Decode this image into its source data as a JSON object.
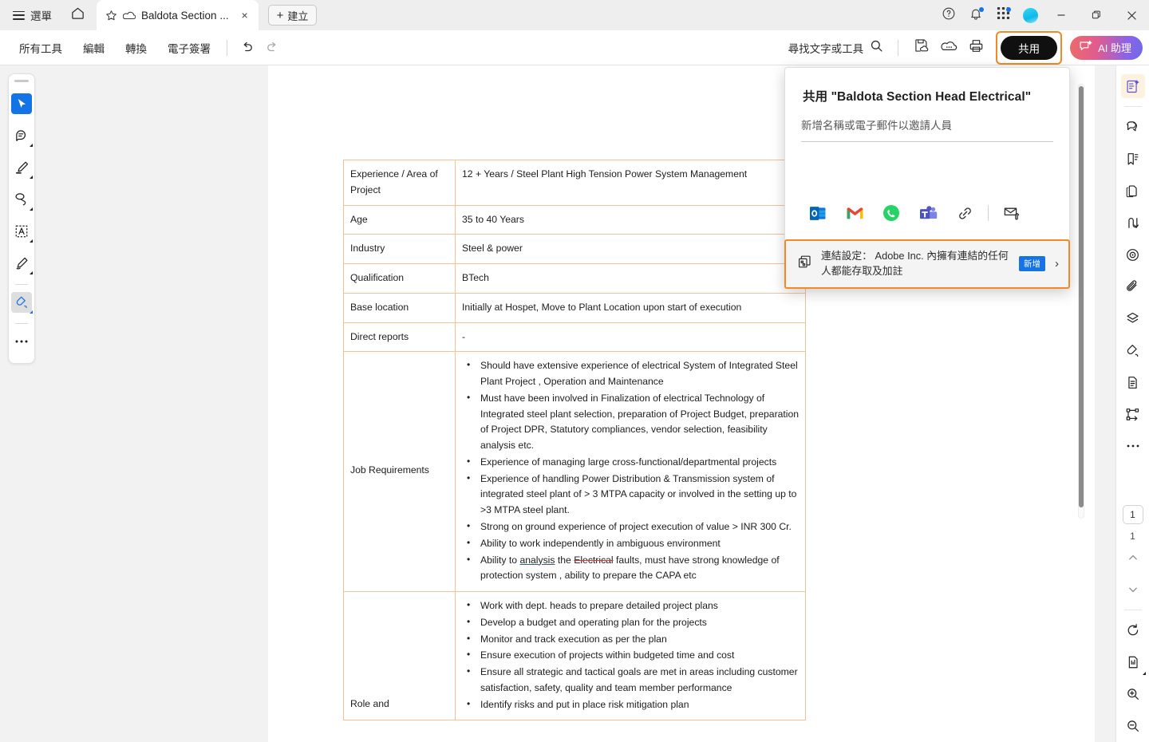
{
  "window": {
    "menu_label": "選單",
    "tab_title": "Baldota Section ...",
    "create_label": "建立",
    "minimize": "–",
    "restore": "restore",
    "close": "×"
  },
  "toolbar": {
    "items": [
      {
        "label": "所有工具",
        "name": "tool-all-tools"
      },
      {
        "label": "編輯",
        "name": "tool-edit"
      },
      {
        "label": "轉換",
        "name": "tool-convert"
      },
      {
        "label": "電子簽署",
        "name": "tool-esign"
      }
    ],
    "find_label": "尋找文字或工具",
    "share_label": "共用",
    "ai_label": "AI 助理",
    "accent_highlight": "#f08a24"
  },
  "leftrail": {
    "tools": [
      {
        "name": "select-tool",
        "label": "選取"
      },
      {
        "name": "comment-tool",
        "label": "註解"
      },
      {
        "name": "highlight-tool",
        "label": "強調"
      },
      {
        "name": "lasso-tool",
        "label": "套索"
      },
      {
        "name": "text-select-tool",
        "label": "文字選取"
      },
      {
        "name": "pen-tool",
        "label": "繪圖"
      },
      {
        "name": "fill-sign-tool",
        "label": "填寫與簽署"
      },
      {
        "name": "more-tools",
        "label": "更多"
      }
    ]
  },
  "rightrail": {
    "tools": [
      {
        "name": "ai-assistant-panel",
        "label": "AI 助理"
      },
      {
        "name": "comments-panel",
        "label": "註解"
      },
      {
        "name": "bookmarks-panel",
        "label": "書籤"
      },
      {
        "name": "organize-pages-panel",
        "label": "整理頁面"
      },
      {
        "name": "export-pdf-panel",
        "label": "匯出 PDF"
      },
      {
        "name": "redact-panel",
        "label": "塗黑"
      },
      {
        "name": "attachments-panel",
        "label": "附件"
      },
      {
        "name": "layers-panel",
        "label": "圖層"
      },
      {
        "name": "fill-sign-panel",
        "label": "填寫與簽署"
      },
      {
        "name": "document-panel",
        "label": "文件"
      },
      {
        "name": "share-workflow-panel",
        "label": "共用工作流程"
      },
      {
        "name": "more-panels",
        "label": "更多"
      }
    ],
    "current_page": "1",
    "total_pages": "1",
    "page_up": "⌃",
    "page_down": "⌄"
  },
  "share_panel": {
    "title": "共用 \"Baldota Section Head Electrical\"",
    "invite_placeholder": "新增名稱或電子郵件以邀請人員",
    "invite_value": "",
    "share_targets": [
      {
        "name": "outlook-share-icon",
        "label": "Outlook"
      },
      {
        "name": "gmail-share-icon",
        "label": "Gmail"
      },
      {
        "name": "whatsapp-share-icon",
        "label": "WhatsApp"
      },
      {
        "name": "teams-share-icon",
        "label": "Microsoft Teams"
      },
      {
        "name": "copy-link-icon",
        "label": "複製連結"
      },
      {
        "name": "email-attachment-icon",
        "label": "以附件傳送電子郵件"
      }
    ],
    "link_settings_text": "連結設定： Adobe Inc. 內擁有連結的任何人都能存取及加註",
    "link_badge": "新增",
    "chevron": "›"
  },
  "document": {
    "rows": [
      {
        "key": "Experience / Area of Project",
        "value": "12 + Years / Steel Plant High Tension Power System Management"
      },
      {
        "key": "Age",
        "value": "35 to 40 Years"
      },
      {
        "key": "Industry",
        "value": "Steel & power"
      },
      {
        "key": "Qualification",
        "value": "BTech"
      },
      {
        "key": "Base location",
        "value": "Initially at Hospet, Move to Plant Location upon start of execution"
      },
      {
        "key": "Direct reports",
        "value": "-"
      }
    ],
    "job_requirements_label": "Job Requirements",
    "job_requirements": [
      "Should have extensive experience of electrical System of Integrated Steel Plant Project , Operation and Maintenance",
      "Must have been involved in Finalization of electrical Technology of Integrated steel plant selection, preparation of Project Budget, preparation of Project DPR, Statutory compliances, vendor selection, feasibility analysis etc.",
      "Experience of managing large cross-functional/departmental projects",
      "Experience of handling Power Distribution & Transmission system of integrated steel plant of > 3 MTPA capacity or involved in the setting up to >3 MTPA steel plant.",
      "Strong on ground experience of project execution of value > INR 300 Cr.",
      "Ability to work independently in ambiguous environment"
    ],
    "job_req_last": {
      "pre": "Ability to ",
      "underlined": "analysis",
      "mid": " the ",
      "struck": "Electrical",
      "post": " faults, must have strong knowledge of protection system , ability to prepare the CAPA etc"
    },
    "role_label": "Role and",
    "role_items": [
      "Work with dept. heads to prepare detailed project plans",
      "Develop a budget and operating plan for the projects",
      "Monitor and track execution as per the plan",
      "Ensure execution of projects within budgeted time and cost",
      "Ensure all strategic and tactical goals are met in areas including customer satisfaction, safety, quality and team member performance",
      "Identify risks and put in place risk mitigation plan"
    ]
  }
}
